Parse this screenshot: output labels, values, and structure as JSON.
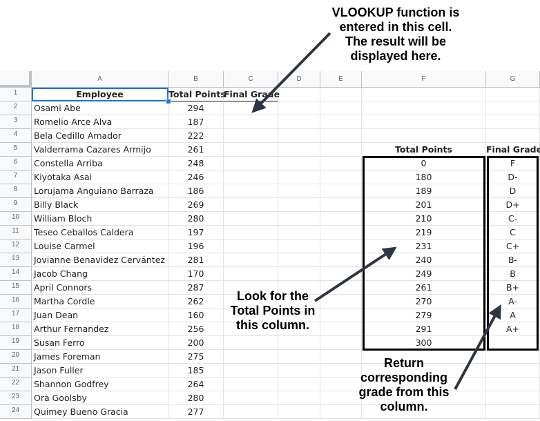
{
  "columns": [
    "A",
    "B",
    "C",
    "D",
    "E",
    "F",
    "G"
  ],
  "row_numbers": [
    "1",
    "2",
    "3",
    "4",
    "5",
    "6",
    "7",
    "8",
    "9",
    "10",
    "11",
    "12",
    "13",
    "14",
    "15",
    "16",
    "17",
    "18",
    "19",
    "20",
    "21",
    "22",
    "23",
    "24"
  ],
  "headers": {
    "employee": "Employee",
    "total_points": "Total Points",
    "final_grade": "Final Grade"
  },
  "employees": [
    {
      "name": "Osami Abe",
      "points": "294"
    },
    {
      "name": "Romelio Arce Alva",
      "points": "187"
    },
    {
      "name": "Bela Cedillo Amador",
      "points": "222"
    },
    {
      "name": "Valderrama Cazares Armijo",
      "points": "261"
    },
    {
      "name": "Constella Arriba",
      "points": "248"
    },
    {
      "name": "Kiyotaka Asai",
      "points": "246"
    },
    {
      "name": "Lorujama Anguiano Barraza",
      "points": "186"
    },
    {
      "name": "Billy Black",
      "points": "269"
    },
    {
      "name": "William Bloch",
      "points": "280"
    },
    {
      "name": "Teseo Ceballos Caldera",
      "points": "197"
    },
    {
      "name": "Louise Carmel",
      "points": "196"
    },
    {
      "name": "Jovianne Benavidez Cervántez",
      "points": "281"
    },
    {
      "name": "Jacob Chang",
      "points": "170"
    },
    {
      "name": "April Connors",
      "points": "287"
    },
    {
      "name": "Martha Cordle",
      "points": "262"
    },
    {
      "name": "Juan Dean",
      "points": "160"
    },
    {
      "name": "Arthur Fernandez",
      "points": "256"
    },
    {
      "name": "Susan Ferro",
      "points": "200"
    },
    {
      "name": "James Foreman",
      "points": "275"
    },
    {
      "name": "Jason Fuller",
      "points": "185"
    },
    {
      "name": "Shannon Godfrey",
      "points": "264"
    },
    {
      "name": "Ora Goolsby",
      "points": "280"
    },
    {
      "name": "Quimey Bueno Gracia",
      "points": "277"
    }
  ],
  "lookup_table": {
    "header_points": "Total Points",
    "header_grade": "Final Grade",
    "rows": [
      {
        "points": "0",
        "grade": "F"
      },
      {
        "points": "180",
        "grade": "D-"
      },
      {
        "points": "189",
        "grade": "D"
      },
      {
        "points": "201",
        "grade": "D+"
      },
      {
        "points": "210",
        "grade": "C-"
      },
      {
        "points": "219",
        "grade": "C"
      },
      {
        "points": "231",
        "grade": "C+"
      },
      {
        "points": "240",
        "grade": "B-"
      },
      {
        "points": "249",
        "grade": "B"
      },
      {
        "points": "261",
        "grade": "B+"
      },
      {
        "points": "270",
        "grade": "A-"
      },
      {
        "points": "279",
        "grade": "A"
      },
      {
        "points": "291",
        "grade": "A+"
      },
      {
        "points": "300",
        "grade": ""
      }
    ]
  },
  "annotations": {
    "vlookup": [
      "VLOOKUP function is",
      "entered in this cell.",
      "The result will be",
      "displayed here."
    ],
    "look_for": [
      "Look for the",
      "Total Points in",
      "this column."
    ],
    "return_grade": [
      "Return",
      "corresponding",
      "grade from this",
      "column."
    ]
  },
  "colors": {
    "selection": "#1a73e8",
    "arrow": "#2f3542"
  }
}
